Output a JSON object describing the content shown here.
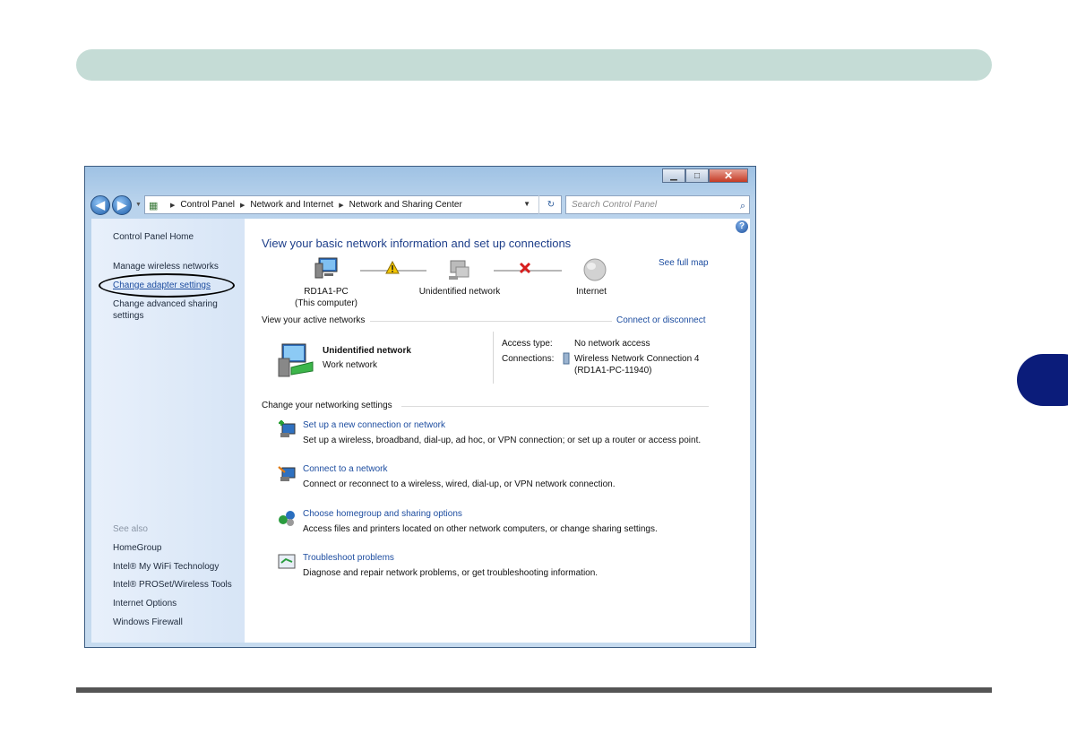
{
  "window": {
    "minimize_glyph": "▁",
    "maximize_glyph": "□",
    "close_glyph": "✕"
  },
  "nav": {
    "back_glyph": "◀",
    "forward_glyph": "▶",
    "breadcrumbs": [
      "Control Panel",
      "Network and Internet",
      "Network and Sharing Center"
    ],
    "refresh_glyph": "↻",
    "search_placeholder": "Search Control Panel",
    "search_icon_glyph": "⌕"
  },
  "sidebar": {
    "home": "Control Panel Home",
    "links": [
      "Manage wireless networks",
      "Change adapter settings",
      "Change advanced sharing settings"
    ],
    "see_also_label": "See also",
    "see_also": [
      "HomeGroup",
      "Intel® My WiFi Technology",
      "Intel® PROSet/Wireless Tools",
      "Internet Options",
      "Windows Firewall"
    ]
  },
  "main": {
    "title": "View your basic network information and set up connections",
    "see_full_map": "See full map",
    "map_nodes": [
      {
        "label": "RD1A1-PC",
        "sublabel": "(This computer)"
      },
      {
        "label": "Unidentified network",
        "sublabel": ""
      },
      {
        "label": "Internet",
        "sublabel": ""
      }
    ],
    "active_networks_label": "View your active networks",
    "connect_or_disconnect": "Connect or disconnect",
    "network_name": "Unidentified network",
    "network_type": "Work network",
    "access_type_label": "Access type:",
    "access_type_value": "No network access",
    "connections_label": "Connections:",
    "connection_name_line1": "Wireless Network Connection 4",
    "connection_name_line2": "(RD1A1-PC-11940)",
    "change_settings_label": "Change your networking settings",
    "tasks": [
      {
        "title": "Set up a new connection or network",
        "desc": "Set up a wireless, broadband, dial-up, ad hoc, or VPN connection; or set up a router or access point."
      },
      {
        "title": "Connect to a network",
        "desc": "Connect or reconnect to a wireless, wired, dial-up, or VPN network connection."
      },
      {
        "title": "Choose homegroup and sharing options",
        "desc": "Access files and printers located on other network computers, or change sharing settings."
      },
      {
        "title": "Troubleshoot problems",
        "desc": "Diagnose and repair network problems, or get troubleshooting information."
      }
    ],
    "help_glyph": "?"
  },
  "colors": {
    "link": "#1d4da0",
    "title": "#1e3f8a",
    "header_bar": "#c5dcd6",
    "chapter_tab": "#0b1c7a"
  }
}
